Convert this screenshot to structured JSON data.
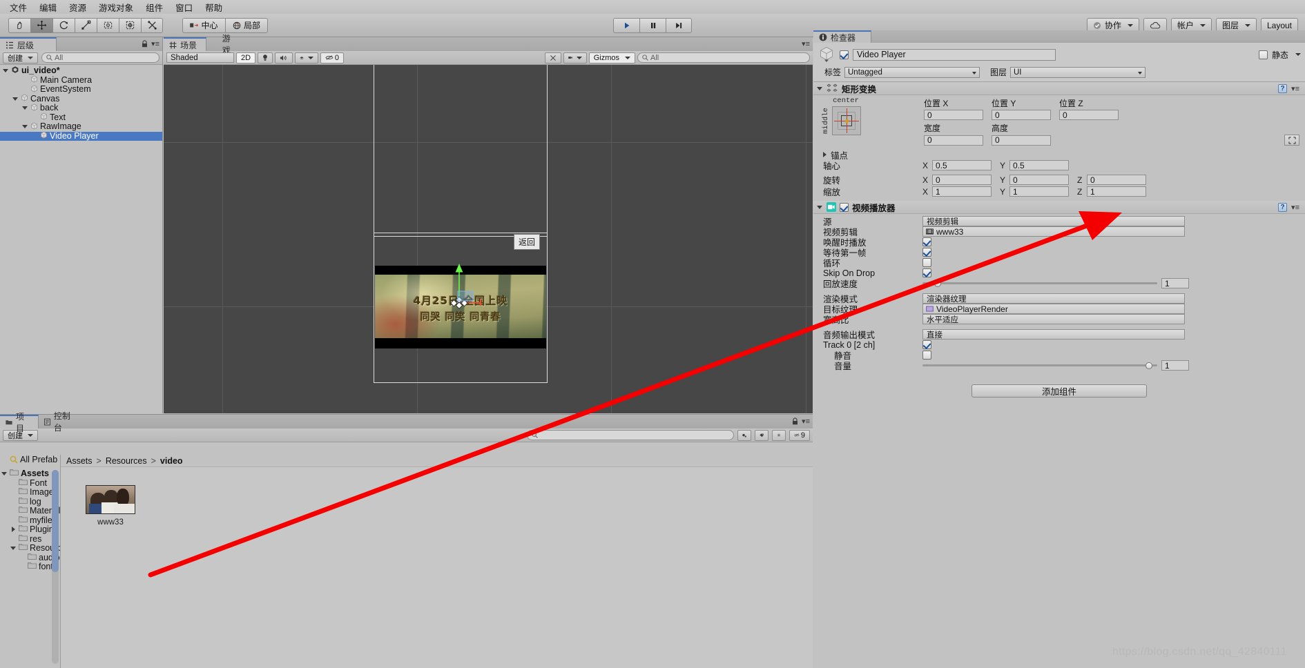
{
  "menu": {
    "items": [
      "文件",
      "编辑",
      "资源",
      "游戏对象",
      "组件",
      "窗口",
      "帮助"
    ]
  },
  "toolbar": {
    "tools": [
      "hand-tool",
      "move-tool",
      "rotate-tool",
      "scale-tool",
      "rect-tool",
      "transform-tool",
      "custom-tool"
    ],
    "pivot_mode": "中心",
    "pivot_space": "局部",
    "play": "play-icon",
    "pause": "pause-icon",
    "step": "step-icon",
    "collab": "协作",
    "cloud": "cloud-icon",
    "account": "帐户",
    "layers": "图层",
    "layout": "Layout"
  },
  "hierarchy": {
    "tab": "层级",
    "create_label": "创建",
    "search_placeholder": "All",
    "nodes": [
      {
        "label": "ui_video*",
        "depth": 0,
        "toggle": "down",
        "icon": "unity-scene-icon",
        "bold": true,
        "selected": false
      },
      {
        "label": "Main Camera",
        "depth": 2,
        "toggle": "none",
        "icon": "gameobject-icon",
        "bold": false,
        "selected": false
      },
      {
        "label": "EventSystem",
        "depth": 2,
        "toggle": "none",
        "icon": "gameobject-icon",
        "bold": false,
        "selected": false
      },
      {
        "label": "Canvas",
        "depth": 1,
        "toggle": "down",
        "icon": "gameobject-icon",
        "bold": false,
        "selected": false
      },
      {
        "label": "back",
        "depth": 2,
        "toggle": "down",
        "icon": "gameobject-icon",
        "bold": false,
        "selected": false
      },
      {
        "label": "Text",
        "depth": 3,
        "toggle": "none",
        "icon": "gameobject-icon",
        "bold": false,
        "selected": false
      },
      {
        "label": "RawImage",
        "depth": 2,
        "toggle": "down",
        "icon": "gameobject-icon",
        "bold": false,
        "selected": false
      },
      {
        "label": "Video Player",
        "depth": 3,
        "toggle": "none",
        "icon": "gameobject-icon",
        "bold": false,
        "selected": true
      }
    ]
  },
  "scene": {
    "tabs": [
      {
        "label": "场景",
        "icon": "scene-grid-icon",
        "selected": true
      },
      {
        "label": "游戏",
        "icon": "game-icon",
        "selected": false
      }
    ],
    "draw_mode": "Shaded",
    "mode_2d": "2D",
    "lighting_icon": "lightbulb-icon",
    "audio_icon": "speaker-icon",
    "fx_icon": "effects-icon",
    "hidden_count": "0",
    "tools_icon": "tools-icon",
    "camera_icon": "camera-icon",
    "gizmos": "Gizmos",
    "search_placeholder": "All",
    "return_button": "返回",
    "video_overlay_line1": "4月25日 全国上映",
    "video_overlay_line2": "同哭  同笑  同青春"
  },
  "project": {
    "tabs": [
      {
        "label": "项目",
        "icon": "folder-icon",
        "selected": true
      },
      {
        "label": "控制台",
        "icon": "console-icon",
        "selected": false
      }
    ],
    "create_label": "创建",
    "search_placeholder": "",
    "favorites_label": "All Prefab",
    "toolbar_icons": [
      "prefab-filter-icon",
      "label-filter-icon",
      "favorite-icon",
      "hidden-icon"
    ],
    "hidden_count": "9",
    "breadcrumb": [
      "Assets",
      "Resources",
      "video"
    ],
    "tree": [
      {
        "label": "Assets",
        "depth": 0,
        "toggle": "down",
        "bold": true
      },
      {
        "label": "Font",
        "depth": 1,
        "toggle": "none",
        "bold": false
      },
      {
        "label": "Image",
        "depth": 1,
        "toggle": "none",
        "bold": false
      },
      {
        "label": "log",
        "depth": 1,
        "toggle": "none",
        "bold": false
      },
      {
        "label": "Materials",
        "depth": 1,
        "toggle": "none",
        "bold": false
      },
      {
        "label": "myfile",
        "depth": 1,
        "toggle": "none",
        "bold": false
      },
      {
        "label": "Plugins",
        "depth": 1,
        "toggle": "right",
        "bold": false
      },
      {
        "label": "res",
        "depth": 1,
        "toggle": "none",
        "bold": false
      },
      {
        "label": "Resource",
        "depth": 1,
        "toggle": "down",
        "bold": false
      },
      {
        "label": "audio",
        "depth": 2,
        "toggle": "none",
        "bold": false
      },
      {
        "label": "font",
        "depth": 2,
        "toggle": "none",
        "bold": false
      }
    ],
    "assets": [
      {
        "name": "www33",
        "type": "video-clip-thumbnail"
      }
    ]
  },
  "inspector": {
    "tab": "检查器",
    "info_icon": "info-icon",
    "object_name": "Video Player",
    "object_enabled": true,
    "static_label": "静态",
    "tag_label": "标签",
    "tag_value": "Untagged",
    "layer_label": "图层",
    "layer_value": "UI",
    "rect_transform": {
      "title": "矩形变换",
      "anchor_preset_h": "center",
      "anchor_preset_v": "middle",
      "pos_x_label": "位置 X",
      "pos_x": "0",
      "pos_y_label": "位置 Y",
      "pos_y": "0",
      "pos_z_label": "位置 Z",
      "pos_z": "0",
      "width_label": "宽度",
      "width": "0",
      "height_label": "高度",
      "height": "0",
      "anchors_label": "锚点",
      "pivot_label": "轴心",
      "pivot_x": "0.5",
      "pivot_y": "0.5",
      "rotation_label": "旋转",
      "rot_x": "0",
      "rot_y": "0",
      "rot_z": "0",
      "scale_label": "缩放",
      "scale_x": "1",
      "scale_y": "1",
      "scale_z": "1",
      "blueprint_icon": "blueprint-mode-icon"
    },
    "video_player": {
      "title": "视频播放器",
      "enabled": true,
      "icon": "video-player-icon",
      "rows": [
        {
          "label": "源",
          "kind": "popup",
          "value": "视频剪辑"
        },
        {
          "label": "视频剪辑",
          "kind": "object",
          "value": "www33"
        },
        {
          "label": "唤醒时播放",
          "kind": "checkbox",
          "value": true
        },
        {
          "label": "等待第一帧",
          "kind": "checkbox",
          "value": true
        },
        {
          "label": "循环",
          "kind": "checkbox",
          "value": false
        },
        {
          "label": "Skip On Drop",
          "kind": "checkbox",
          "value": true
        },
        {
          "label": "回放速度",
          "kind": "slider",
          "value": "1",
          "fill": 0.05
        },
        {
          "label": "",
          "kind": "spacer",
          "value": ""
        },
        {
          "label": "渲染模式",
          "kind": "popup",
          "value": "渲染器纹理"
        },
        {
          "label": "目标纹理",
          "kind": "object",
          "value": "VideoPlayerRender"
        },
        {
          "label": "宽高比",
          "kind": "popup",
          "value": "水平适应"
        },
        {
          "label": "",
          "kind": "spacer",
          "value": ""
        },
        {
          "label": "音频输出模式",
          "kind": "popup",
          "value": "直接"
        },
        {
          "label": "Track 0 [2 ch]",
          "kind": "checkbox",
          "value": true
        },
        {
          "label": "静音",
          "kind": "checkbox-indent",
          "value": false
        },
        {
          "label": "音量",
          "kind": "slider-indent",
          "value": "1",
          "fill": 0.98
        }
      ]
    },
    "add_component": "添加组件"
  },
  "watermark": "https://blog.csdn.net/qq_42840111",
  "colors": {
    "selection_blue": "#4a79c4",
    "tab_accent": "#4a74b8",
    "arrow_red": "#f50000",
    "gizmo_green": "#6cf54a",
    "gizmo_red": "#f54a2a",
    "panel_bg": "#c2c2c2",
    "scene_bg": "#474747"
  }
}
